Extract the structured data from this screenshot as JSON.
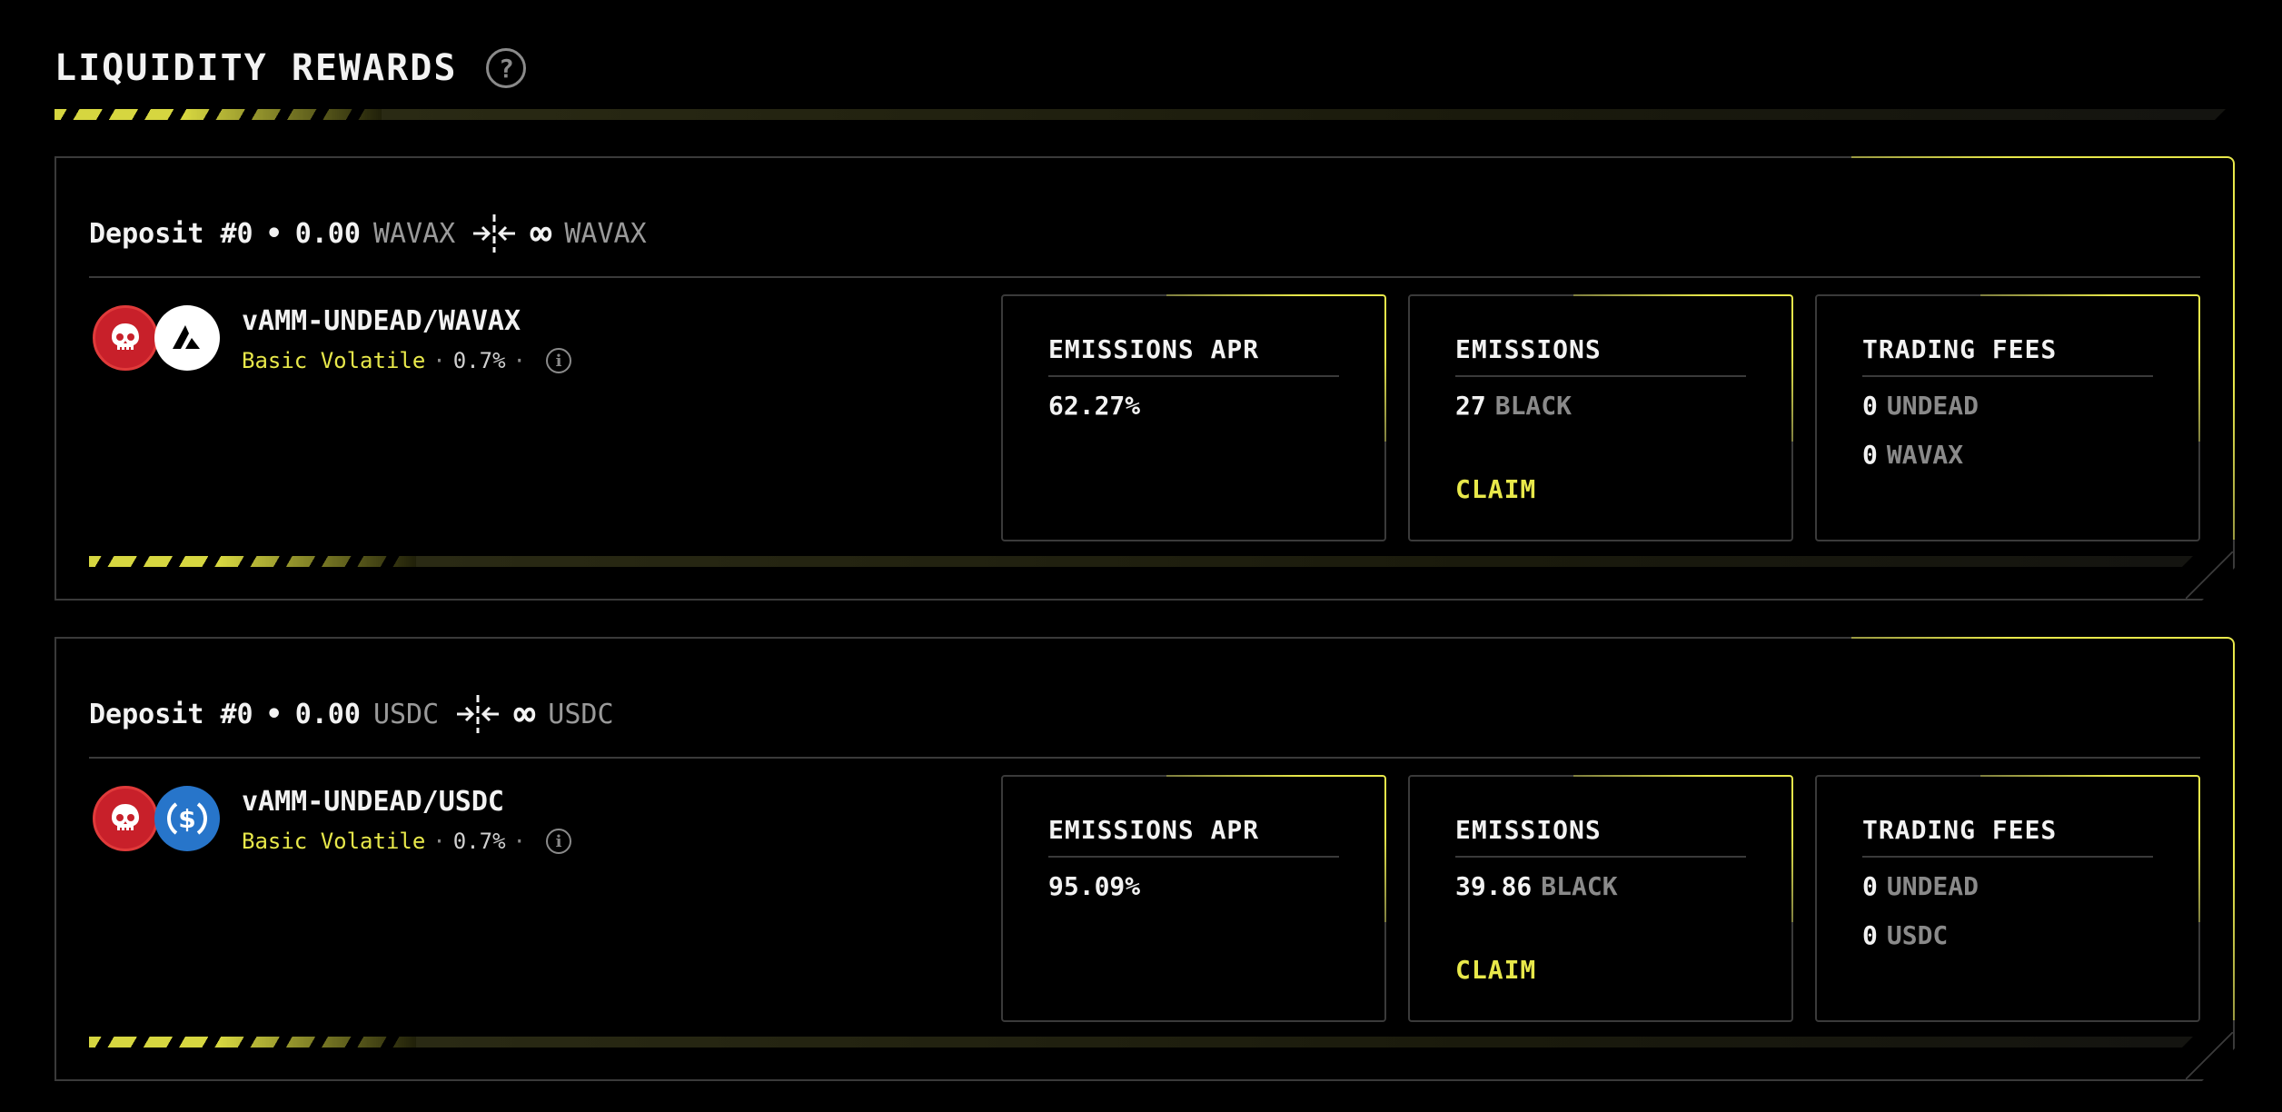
{
  "header": {
    "title": "LIQUIDITY REWARDS"
  },
  "deposits": [
    {
      "label": "Deposit #0",
      "separator": "•",
      "amount": "0.00",
      "min_token": "WAVAX",
      "infinity": "∞",
      "max_token": "WAVAX",
      "pool_name": "vAMM-UNDEAD/WAVAX",
      "pool_type": "Basic Volatile",
      "dot": "·",
      "fee": "0.7%",
      "emissions_apr_label": "EMISSIONS APR",
      "emissions_apr": "62.27%",
      "emissions_label": "EMISSIONS",
      "emissions_value": "27",
      "emissions_unit": "BLACK",
      "claim_label": "CLAIM",
      "trading_fees_label": "TRADING FEES",
      "fee_token_a_value": "0",
      "fee_token_a": "UNDEAD",
      "fee_token_b_value": "0",
      "fee_token_b": "WAVAX",
      "icons": [
        "skull-icon",
        "avalanche-icon"
      ]
    },
    {
      "label": "Deposit #0",
      "separator": "•",
      "amount": "0.00",
      "min_token": "USDC",
      "infinity": "∞",
      "max_token": "USDC",
      "pool_name": "vAMM-UNDEAD/USDC",
      "pool_type": "Basic Volatile",
      "dot": "·",
      "fee": "0.7%",
      "emissions_apr_label": "EMISSIONS APR",
      "emissions_apr": "95.09%",
      "emissions_label": "EMISSIONS",
      "emissions_value": "39.86",
      "emissions_unit": "BLACK",
      "claim_label": "CLAIM",
      "trading_fees_label": "TRADING FEES",
      "fee_token_a_value": "0",
      "fee_token_a": "UNDEAD",
      "fee_token_b_value": "0",
      "fee_token_b": "USDC",
      "icons": [
        "skull-icon",
        "usdc-icon"
      ]
    }
  ],
  "colors": {
    "accent": "#e8e84a",
    "background": "#000000",
    "muted": "#8a8a8a",
    "border": "#3a3a3a"
  }
}
